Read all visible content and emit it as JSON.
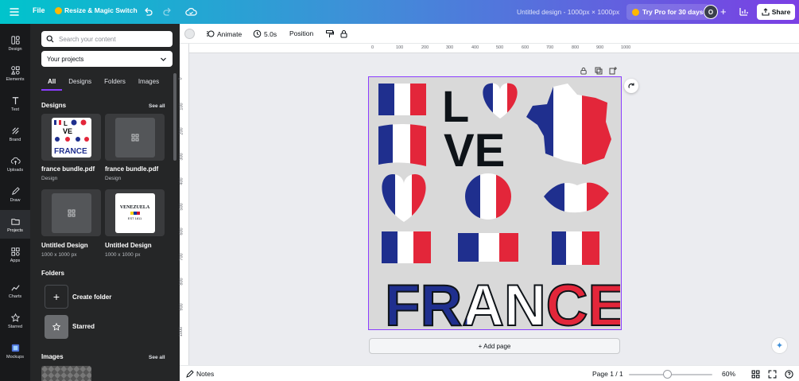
{
  "topbar": {
    "file_label": "File",
    "resize_label": "Resize & Magic Switch",
    "design_title": "Untitled design - 1000px × 1000px",
    "pro_label": "Try Pro for 30 days",
    "avatar_initial": "O",
    "share_label": "Share"
  },
  "rail": {
    "items": [
      {
        "label": "Design",
        "icon": "design-icon"
      },
      {
        "label": "Elements",
        "icon": "elements-icon"
      },
      {
        "label": "Text",
        "icon": "text-icon"
      },
      {
        "label": "Brand",
        "icon": "brand-icon"
      },
      {
        "label": "Uploads",
        "icon": "uploads-icon"
      },
      {
        "label": "Draw",
        "icon": "draw-icon"
      },
      {
        "label": "Projects",
        "icon": "projects-icon"
      },
      {
        "label": "Apps",
        "icon": "apps-icon"
      },
      {
        "label": "Charts",
        "icon": "charts-icon"
      },
      {
        "label": "Starred",
        "icon": "star-icon"
      },
      {
        "label": "Mockups",
        "icon": "mockups-icon"
      }
    ],
    "active": "Projects"
  },
  "panel": {
    "search_placeholder": "Search your content",
    "filter_value": "Your projects",
    "tabs": [
      "All",
      "Designs",
      "Folders",
      "Images"
    ],
    "active_tab": "All",
    "designs_heading": "Designs",
    "see_all": "See all",
    "designs": [
      {
        "name": "france bundle.pdf",
        "sub": "Design"
      },
      {
        "name": "france bundle.pdf",
        "sub": "Design"
      },
      {
        "name": "Untitled Design",
        "sub": "1000 x 1000 px"
      },
      {
        "name": "Untitled Design",
        "sub": "1000 x 1000 px"
      }
    ],
    "venezuela_thumb": {
      "line1": "VENEZUELA",
      "line2": "EST 1811"
    },
    "france_thumb": {
      "word": "FRANCE",
      "ve": "VE"
    },
    "folders_heading": "Folders",
    "create_folder": "Create folder",
    "starred": "Starred",
    "images_heading": "Images",
    "images_see_all": "See all"
  },
  "toolbar": {
    "animate": "Animate",
    "duration": "5.0s",
    "position": "Position"
  },
  "rulers": {
    "top": [
      "0",
      "100",
      "200",
      "300",
      "400",
      "500",
      "600",
      "700",
      "800",
      "900",
      "1000"
    ],
    "left": [
      "0",
      "100",
      "200",
      "300",
      "400",
      "500",
      "600",
      "700",
      "800",
      "900",
      "1000"
    ]
  },
  "canvas": {
    "love_l": "L",
    "love_ve": "VE",
    "france_word": "FRANCE",
    "add_page": "+ Add page",
    "colors": {
      "blue": "#1f2f8e",
      "white": "#ffffff",
      "red": "#e3263a",
      "bg": "#d9d9d9"
    }
  },
  "bottombar": {
    "notes": "Notes",
    "page": "Page 1 / 1",
    "zoom": "60%",
    "zoom_fraction": 0.6
  }
}
